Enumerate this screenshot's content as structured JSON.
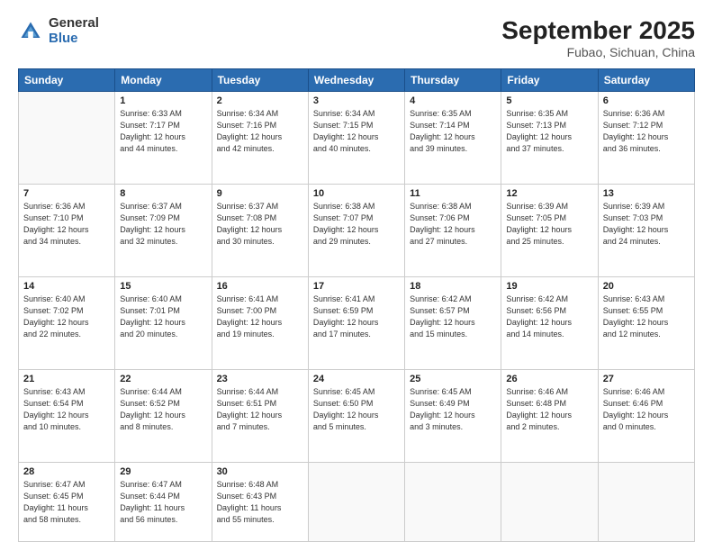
{
  "header": {
    "logo_general": "General",
    "logo_blue": "Blue",
    "month_title": "September 2025",
    "subtitle": "Fubao, Sichuan, China"
  },
  "days_of_week": [
    "Sunday",
    "Monday",
    "Tuesday",
    "Wednesday",
    "Thursday",
    "Friday",
    "Saturday"
  ],
  "weeks": [
    [
      {
        "day": "",
        "info": ""
      },
      {
        "day": "1",
        "info": "Sunrise: 6:33 AM\nSunset: 7:17 PM\nDaylight: 12 hours\nand 44 minutes."
      },
      {
        "day": "2",
        "info": "Sunrise: 6:34 AM\nSunset: 7:16 PM\nDaylight: 12 hours\nand 42 minutes."
      },
      {
        "day": "3",
        "info": "Sunrise: 6:34 AM\nSunset: 7:15 PM\nDaylight: 12 hours\nand 40 minutes."
      },
      {
        "day": "4",
        "info": "Sunrise: 6:35 AM\nSunset: 7:14 PM\nDaylight: 12 hours\nand 39 minutes."
      },
      {
        "day": "5",
        "info": "Sunrise: 6:35 AM\nSunset: 7:13 PM\nDaylight: 12 hours\nand 37 minutes."
      },
      {
        "day": "6",
        "info": "Sunrise: 6:36 AM\nSunset: 7:12 PM\nDaylight: 12 hours\nand 36 minutes."
      }
    ],
    [
      {
        "day": "7",
        "info": "Sunrise: 6:36 AM\nSunset: 7:10 PM\nDaylight: 12 hours\nand 34 minutes."
      },
      {
        "day": "8",
        "info": "Sunrise: 6:37 AM\nSunset: 7:09 PM\nDaylight: 12 hours\nand 32 minutes."
      },
      {
        "day": "9",
        "info": "Sunrise: 6:37 AM\nSunset: 7:08 PM\nDaylight: 12 hours\nand 30 minutes."
      },
      {
        "day": "10",
        "info": "Sunrise: 6:38 AM\nSunset: 7:07 PM\nDaylight: 12 hours\nand 29 minutes."
      },
      {
        "day": "11",
        "info": "Sunrise: 6:38 AM\nSunset: 7:06 PM\nDaylight: 12 hours\nand 27 minutes."
      },
      {
        "day": "12",
        "info": "Sunrise: 6:39 AM\nSunset: 7:05 PM\nDaylight: 12 hours\nand 25 minutes."
      },
      {
        "day": "13",
        "info": "Sunrise: 6:39 AM\nSunset: 7:03 PM\nDaylight: 12 hours\nand 24 minutes."
      }
    ],
    [
      {
        "day": "14",
        "info": "Sunrise: 6:40 AM\nSunset: 7:02 PM\nDaylight: 12 hours\nand 22 minutes."
      },
      {
        "day": "15",
        "info": "Sunrise: 6:40 AM\nSunset: 7:01 PM\nDaylight: 12 hours\nand 20 minutes."
      },
      {
        "day": "16",
        "info": "Sunrise: 6:41 AM\nSunset: 7:00 PM\nDaylight: 12 hours\nand 19 minutes."
      },
      {
        "day": "17",
        "info": "Sunrise: 6:41 AM\nSunset: 6:59 PM\nDaylight: 12 hours\nand 17 minutes."
      },
      {
        "day": "18",
        "info": "Sunrise: 6:42 AM\nSunset: 6:57 PM\nDaylight: 12 hours\nand 15 minutes."
      },
      {
        "day": "19",
        "info": "Sunrise: 6:42 AM\nSunset: 6:56 PM\nDaylight: 12 hours\nand 14 minutes."
      },
      {
        "day": "20",
        "info": "Sunrise: 6:43 AM\nSunset: 6:55 PM\nDaylight: 12 hours\nand 12 minutes."
      }
    ],
    [
      {
        "day": "21",
        "info": "Sunrise: 6:43 AM\nSunset: 6:54 PM\nDaylight: 12 hours\nand 10 minutes."
      },
      {
        "day": "22",
        "info": "Sunrise: 6:44 AM\nSunset: 6:52 PM\nDaylight: 12 hours\nand 8 minutes."
      },
      {
        "day": "23",
        "info": "Sunrise: 6:44 AM\nSunset: 6:51 PM\nDaylight: 12 hours\nand 7 minutes."
      },
      {
        "day": "24",
        "info": "Sunrise: 6:45 AM\nSunset: 6:50 PM\nDaylight: 12 hours\nand 5 minutes."
      },
      {
        "day": "25",
        "info": "Sunrise: 6:45 AM\nSunset: 6:49 PM\nDaylight: 12 hours\nand 3 minutes."
      },
      {
        "day": "26",
        "info": "Sunrise: 6:46 AM\nSunset: 6:48 PM\nDaylight: 12 hours\nand 2 minutes."
      },
      {
        "day": "27",
        "info": "Sunrise: 6:46 AM\nSunset: 6:46 PM\nDaylight: 12 hours\nand 0 minutes."
      }
    ],
    [
      {
        "day": "28",
        "info": "Sunrise: 6:47 AM\nSunset: 6:45 PM\nDaylight: 11 hours\nand 58 minutes."
      },
      {
        "day": "29",
        "info": "Sunrise: 6:47 AM\nSunset: 6:44 PM\nDaylight: 11 hours\nand 56 minutes."
      },
      {
        "day": "30",
        "info": "Sunrise: 6:48 AM\nSunset: 6:43 PM\nDaylight: 11 hours\nand 55 minutes."
      },
      {
        "day": "",
        "info": ""
      },
      {
        "day": "",
        "info": ""
      },
      {
        "day": "",
        "info": ""
      },
      {
        "day": "",
        "info": ""
      }
    ]
  ]
}
